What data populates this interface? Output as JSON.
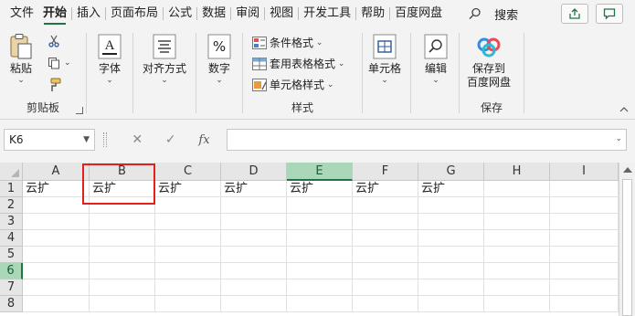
{
  "menu": {
    "tabs": [
      "文件",
      "开始",
      "插入",
      "页面布局",
      "公式",
      "数据",
      "审阅",
      "视图",
      "开发工具",
      "帮助",
      "百度网盘"
    ],
    "active_index": 1,
    "search_label": "搜索"
  },
  "ribbon": {
    "clipboard": {
      "paste": "粘贴",
      "group": "剪贴板"
    },
    "font": {
      "label": "字体"
    },
    "align": {
      "label": "对齐方式"
    },
    "number": {
      "label": "数字"
    },
    "styles": {
      "cond": "条件格式",
      "table": "套用表格格式",
      "cell": "单元格样式",
      "group": "样式"
    },
    "cells": {
      "label": "单元格"
    },
    "edit": {
      "label": "编辑"
    },
    "save": {
      "line1": "保存到",
      "line2": "百度网盘",
      "group": "保存"
    }
  },
  "formula_bar": {
    "name_box": "K6",
    "fx": "fx",
    "value": ""
  },
  "sheet": {
    "columns": [
      "A",
      "B",
      "C",
      "D",
      "E",
      "F",
      "G",
      "H",
      "I"
    ],
    "selected_column": "E",
    "rows": [
      "1",
      "2",
      "3",
      "4",
      "5",
      "6",
      "7",
      "8"
    ],
    "selected_row": "6",
    "row1_values": [
      "云扩",
      "云扩",
      "云扩",
      "云扩",
      "云扩",
      "云扩",
      "云扩",
      "",
      ""
    ]
  },
  "colors": {
    "accent": "#217346",
    "highlight": "#e32020",
    "selected_header": "#a9d7b8"
  }
}
